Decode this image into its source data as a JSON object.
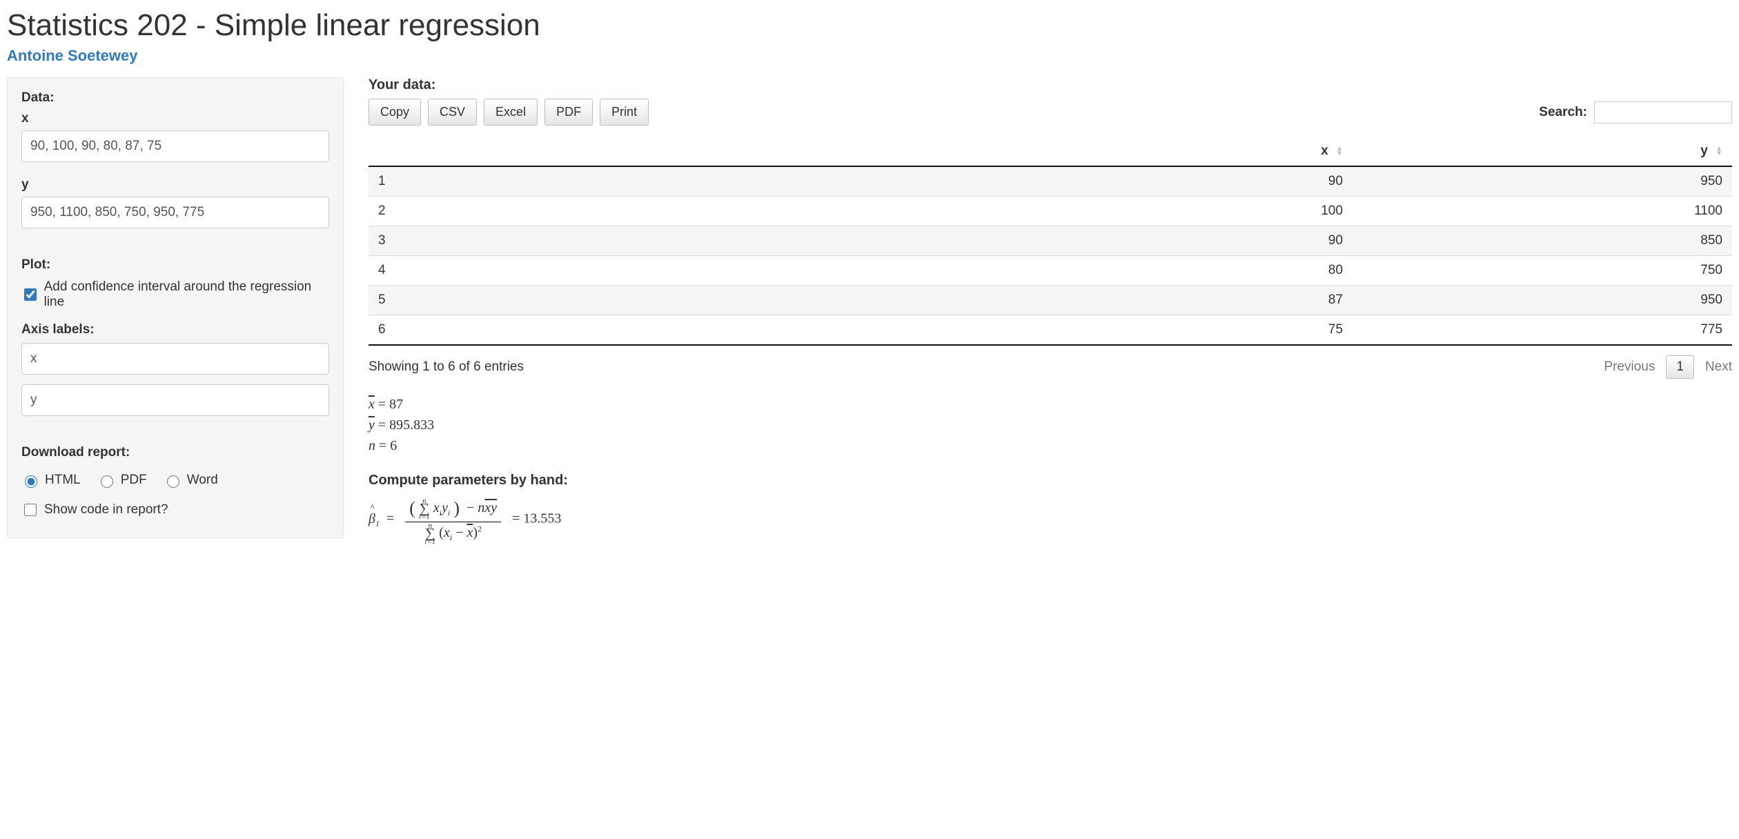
{
  "title": "Statistics 202 - Simple linear regression",
  "author": "Antoine Soetewey",
  "sidebar": {
    "data_label": "Data:",
    "x_label": "x",
    "x_value": "90, 100, 90, 80, 87, 75",
    "y_label": "y",
    "y_value": "950, 1100, 850, 750, 950, 775",
    "plot_label": "Plot:",
    "ci_label": "Add confidence interval around the regression line",
    "ci_checked": true,
    "axis_labels_label": "Axis labels:",
    "axis_x_value": "x",
    "axis_y_value": "y",
    "download_label": "Download report:",
    "radios": {
      "html": "HTML",
      "pdf": "PDF",
      "word": "Word"
    },
    "radio_selected": "html",
    "show_code_label": "Show code in report?",
    "show_code_checked": false
  },
  "main": {
    "your_data_label": "Your data:",
    "buttons": {
      "copy": "Copy",
      "csv": "CSV",
      "excel": "Excel",
      "pdf": "PDF",
      "print": "Print"
    },
    "search_label": "Search:",
    "search_value": "",
    "table": {
      "headers": {
        "idx": "",
        "x": "x",
        "y": "y"
      },
      "rows": [
        {
          "idx": "1",
          "x": "90",
          "y": "950"
        },
        {
          "idx": "2",
          "x": "100",
          "y": "1100"
        },
        {
          "idx": "3",
          "x": "90",
          "y": "850"
        },
        {
          "idx": "4",
          "x": "80",
          "y": "750"
        },
        {
          "idx": "5",
          "x": "87",
          "y": "950"
        },
        {
          "idx": "6",
          "x": "75",
          "y": "775"
        }
      ],
      "info": "Showing 1 to 6 of 6 entries",
      "prev": "Previous",
      "page": "1",
      "next": "Next"
    },
    "stats": {
      "xbar": "87",
      "ybar": "895.833",
      "n": "6",
      "compute_hdr": "Compute parameters by hand:",
      "beta1": "13.553"
    }
  }
}
